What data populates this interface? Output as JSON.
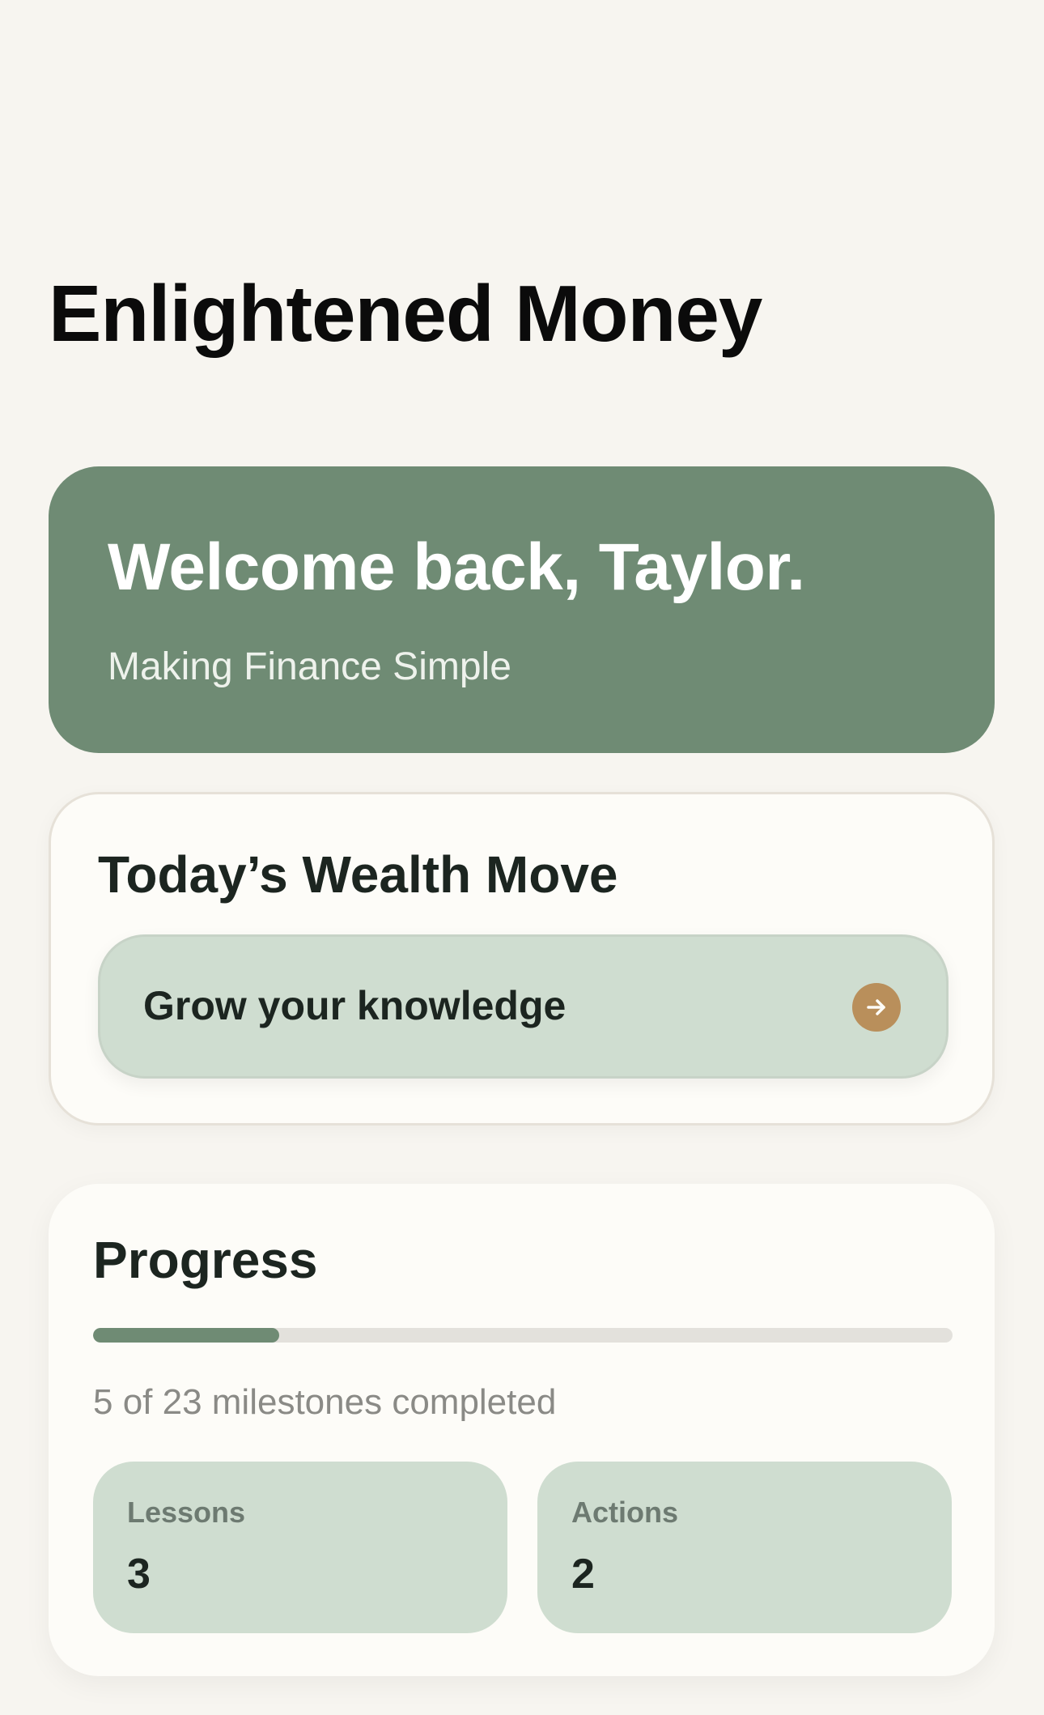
{
  "app": {
    "title": "Enlightened Money"
  },
  "welcome": {
    "greeting": "Welcome back, Taylor.",
    "tagline": "Making Finance Simple"
  },
  "wealth_move": {
    "title": "Today’s Wealth Move",
    "action_label": "Grow your knowledge",
    "action_icon": "arrow-right-icon"
  },
  "progress": {
    "title": "Progress",
    "completed": 5,
    "total": 23,
    "fraction": 0.217,
    "summary": "5 of 23 milestones completed",
    "stats": [
      {
        "label": "Lessons",
        "value": "3"
      },
      {
        "label": "Actions",
        "value": "2"
      }
    ]
  },
  "colors": {
    "background": "#f7f5f0",
    "accent_green": "#6f8b74",
    "tile_green": "#cfddd0",
    "arrow_accent": "#b98f5b",
    "text_dark": "#1c2520"
  }
}
